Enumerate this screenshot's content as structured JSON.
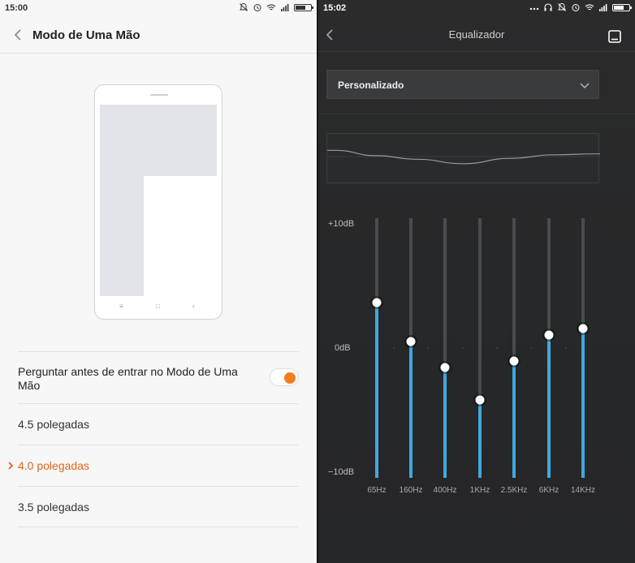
{
  "left": {
    "status": {
      "time": "15:00"
    },
    "header": {
      "title": "Modo de Uma Mão"
    },
    "ask_toggle": {
      "label": "Perguntar antes de entrar no Modo de Uma Mão",
      "on": true
    },
    "options": [
      {
        "label": "4.5 polegadas",
        "selected": false
      },
      {
        "label": "4.0 polegadas",
        "selected": true
      },
      {
        "label": "3.5 polegadas",
        "selected": false
      }
    ],
    "colors": {
      "accent": "#f47e1c",
      "selected_text": "#e0671d"
    },
    "icons": [
      "back-arrow-icon",
      "mute-icon",
      "alarm-icon",
      "wifi-icon",
      "signal-icon",
      "battery-icon",
      "check-chevron-icon"
    ]
  },
  "right": {
    "status": {
      "time": "15:02"
    },
    "header": {
      "title": "Equalizador"
    },
    "preset": {
      "value": "Personalizado"
    },
    "eq": {
      "db_max_label": "+10dB",
      "db_mid_label": "0dB",
      "db_min_label": "−10dB",
      "db_range": [
        -10,
        10
      ],
      "bands": [
        {
          "freq": "65Hz",
          "value": 3.5
        },
        {
          "freq": "160Hz",
          "value": 0.5
        },
        {
          "freq": "400Hz",
          "value": -1.5
        },
        {
          "freq": "1KHz",
          "value": -4
        },
        {
          "freq": "2.5KHz",
          "value": -1
        },
        {
          "freq": "6KHz",
          "value": 1
        },
        {
          "freq": "14KHz",
          "value": 1.5
        }
      ]
    },
    "colors": {
      "bar_fill": "#3fa9dc",
      "track": "#4a4b4d",
      "knob": "#ffffff"
    },
    "icons": [
      "back-arrow-icon",
      "save-icon",
      "chevron-down-icon",
      "more-dots-icon",
      "mute-icon",
      "alarm-icon",
      "wifi-icon",
      "signal-icon",
      "battery-icon"
    ]
  }
}
